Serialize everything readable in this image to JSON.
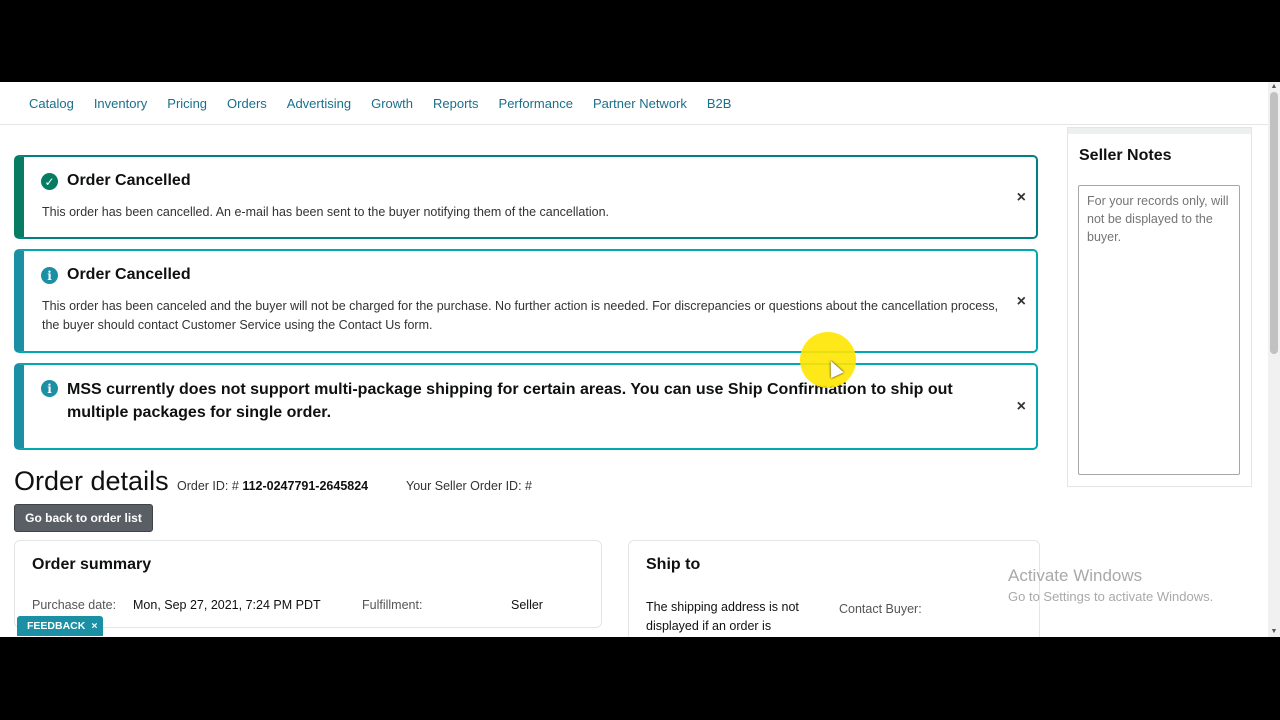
{
  "nav": {
    "items": [
      "Catalog",
      "Inventory",
      "Pricing",
      "Orders",
      "Advertising",
      "Growth",
      "Reports",
      "Performance",
      "Partner Network",
      "B2B"
    ]
  },
  "alerts": [
    {
      "type": "success",
      "title": "Order Cancelled",
      "body": "This order has been cancelled. An e-mail has been sent to the buyer notifying them of the cancellation.",
      "close": "×"
    },
    {
      "type": "info",
      "title": "Order Cancelled",
      "body": "This order has been canceled and the buyer will not be charged for the purchase. No further action is needed. For discrepancies or questions about the cancellation process, the buyer should contact Customer Service using the Contact Us form.",
      "close": "×"
    },
    {
      "type": "info",
      "title": "MSS currently does not support multi-package shipping for certain areas. You can use Ship Confirmation to ship out multiple packages for single order.",
      "close": "×"
    }
  ],
  "order_details": {
    "title": "Order details",
    "order_id_label": "Order ID: #",
    "order_id": "112-0247791-2645824",
    "seller_order_id_label": "Your Seller Order ID: #",
    "back_button": "Go back to order list"
  },
  "order_summary": {
    "title": "Order summary",
    "purchase_date_label": "Purchase date:",
    "purchase_date": "Mon, Sep 27, 2021, 7:24 PM PDT",
    "fulfillment_label": "Fulfillment:",
    "fulfillment": "Seller"
  },
  "ship_to": {
    "title": "Ship to",
    "note_line1": "The shipping address is not",
    "note_line2": "displayed if an order is",
    "contact_label": "Contact Buyer:"
  },
  "seller_notes": {
    "title": "Seller Notes",
    "placeholder": "For your records only, will not be displayed to the buyer."
  },
  "watermark": {
    "line1": "Activate Windows",
    "line2": "Go to Settings to activate Windows."
  },
  "feedback": {
    "label": "FEEDBACK",
    "close": "×"
  },
  "colors": {
    "success": "#067d62",
    "info": "#1b8fa3",
    "link": "#1a6f8b"
  }
}
